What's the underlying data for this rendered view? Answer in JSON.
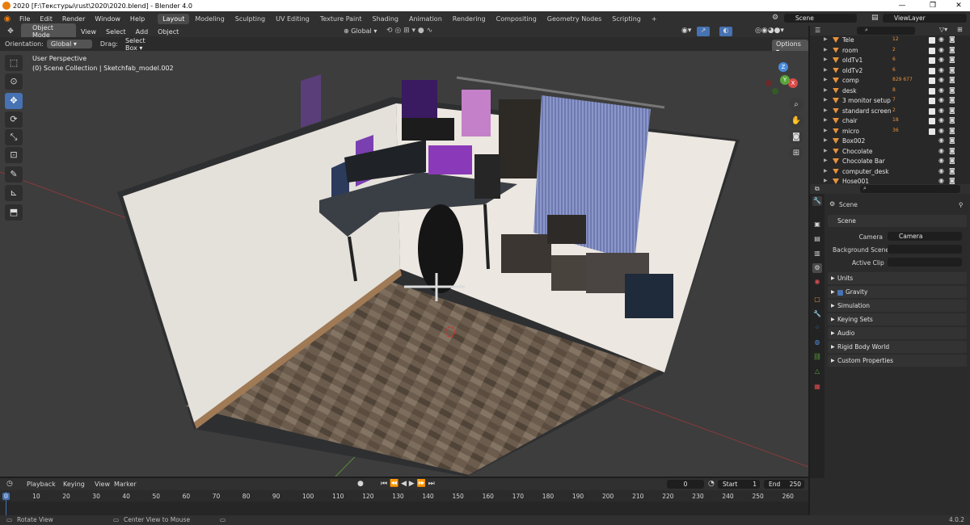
{
  "window": {
    "title": "2020 [F:\\Текстуры\\rust\\2020\\2020.blend] - Blender 4.0",
    "controls": [
      "—",
      "❐",
      "✕"
    ]
  },
  "menu": [
    "File",
    "Edit",
    "Render",
    "Window",
    "Help"
  ],
  "workspaces": [
    "Layout",
    "Modeling",
    "Sculpting",
    "UV Editing",
    "Texture Paint",
    "Shading",
    "Animation",
    "Rendering",
    "Compositing",
    "Geometry Nodes",
    "Scripting",
    "+"
  ],
  "active_workspace": "Layout",
  "scene": {
    "name": "Scene",
    "view_layer": "ViewLayer"
  },
  "viewport_header": {
    "mode": "Object Mode",
    "menus": [
      "View",
      "Select",
      "Add",
      "Object"
    ],
    "transform_orientation": "Global"
  },
  "tool_settings": {
    "orientation_label": "Orientation:",
    "orientation": "Global",
    "drag_label": "Drag:",
    "drag": "Select Box",
    "options": "Options"
  },
  "viewport": {
    "perspective": "User Perspective",
    "collection": "(0) Scene Collection | Sketchfab_model.002"
  },
  "gizmo": {
    "x": "X",
    "y": "Y",
    "z": "Z"
  },
  "outliner": {
    "search_placeholder": "",
    "items": [
      {
        "name": "Tele",
        "count": "12"
      },
      {
        "name": "room",
        "count": "2"
      },
      {
        "name": "oldTv1",
        "count": "6"
      },
      {
        "name": "oldTv2",
        "count": "6"
      },
      {
        "name": "comp",
        "count": "829 677"
      },
      {
        "name": "desk",
        "count": "8"
      },
      {
        "name": "3 monitor setup",
        "count": "7"
      },
      {
        "name": "standard screen",
        "count": "2"
      },
      {
        "name": "chair",
        "count": "18"
      },
      {
        "name": "micro",
        "count": "36"
      },
      {
        "name": "Box002",
        "count": ""
      },
      {
        "name": "Chocolate",
        "count": ""
      },
      {
        "name": "Chocolate Bar",
        "count": ""
      },
      {
        "name": "computer_desk",
        "count": ""
      },
      {
        "name": "Hose001",
        "count": ""
      }
    ]
  },
  "properties": {
    "context": "Scene",
    "panel": "Scene",
    "camera_label": "Camera",
    "camera_value": "Camera",
    "bg_label": "Background Scene",
    "bg_value": "",
    "clip_label": "Active Clip",
    "clip_value": "",
    "sections": [
      "Units",
      "Gravity",
      "Simulation",
      "Keying Sets",
      "Audio",
      "Rigid Body World",
      "Custom Properties"
    ],
    "gravity_checked": true
  },
  "timeline": {
    "menus": [
      "Playback",
      "Keying",
      "View",
      "Marker"
    ],
    "current_frame": "0",
    "start_label": "Start",
    "start": "1",
    "end_label": "End",
    "end": "250",
    "ticks": [
      "0",
      "10",
      "20",
      "30",
      "40",
      "50",
      "60",
      "70",
      "80",
      "90",
      "100",
      "110",
      "120",
      "130",
      "140",
      "150",
      "160",
      "170",
      "180",
      "190",
      "200",
      "210",
      "220",
      "230",
      "240",
      "250",
      "260"
    ],
    "current_tick": "0"
  },
  "status": {
    "left": "Rotate View",
    "middle": "Center View to Mouse",
    "version": "4.0.2"
  },
  "colors": {
    "accent": "#4772b3",
    "orange": "#e8913d",
    "header": "#303030",
    "panel": "#2b2b2b"
  }
}
